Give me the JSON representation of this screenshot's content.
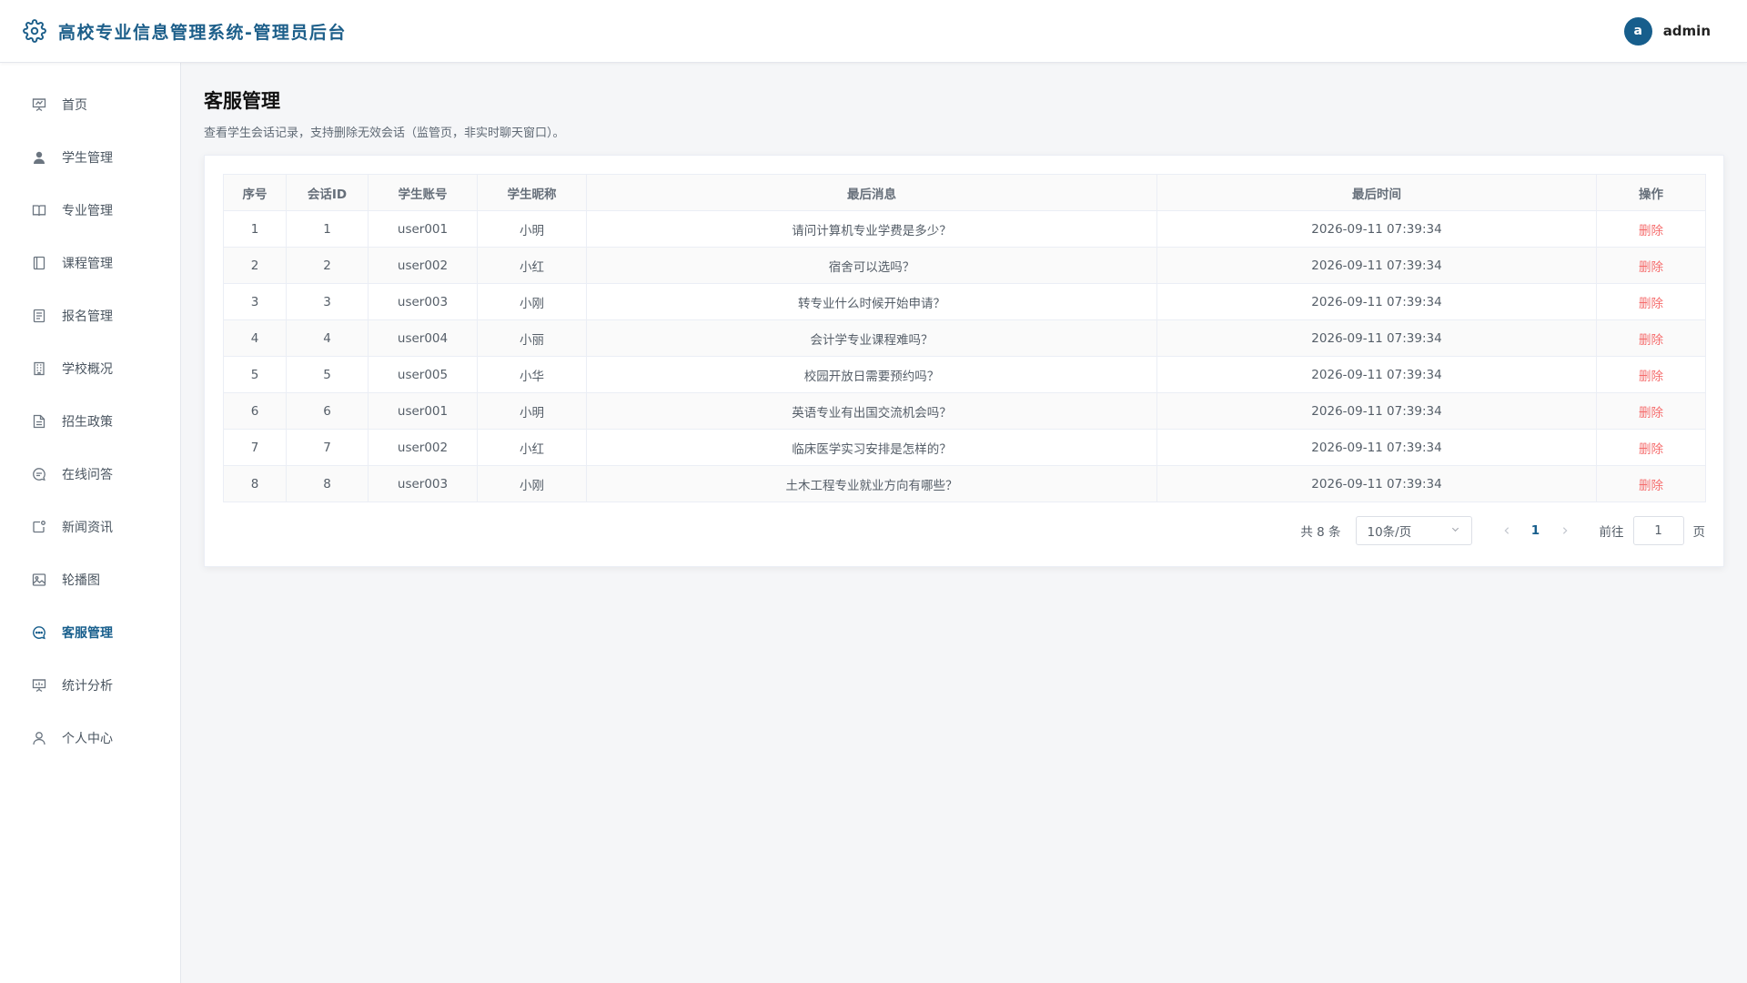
{
  "header": {
    "app_title": "高校专业信息管理系统-管理员后台",
    "avatar_letter": "a",
    "username": "admin"
  },
  "sidebar": {
    "items": [
      {
        "label": "首页",
        "icon": "presentation-icon"
      },
      {
        "label": "学生管理",
        "icon": "user-filled-icon"
      },
      {
        "label": "专业管理",
        "icon": "book-open-icon"
      },
      {
        "label": "课程管理",
        "icon": "notebook-icon"
      },
      {
        "label": "报名管理",
        "icon": "document-icon"
      },
      {
        "label": "学校概况",
        "icon": "office-building-icon"
      },
      {
        "label": "招生政策",
        "icon": "document-lines-icon"
      },
      {
        "label": "在线问答",
        "icon": "chat-line-round-icon"
      },
      {
        "label": "新闻资讯",
        "icon": "news-icon"
      },
      {
        "label": "轮播图",
        "icon": "picture-icon"
      },
      {
        "label": "客服管理",
        "icon": "chat-dots-icon",
        "active": true
      },
      {
        "label": "统计分析",
        "icon": "data-board-icon"
      },
      {
        "label": "个人中心",
        "icon": "user-icon"
      }
    ]
  },
  "main": {
    "title": "客服管理",
    "description": "查看学生会话记录，支持删除无效会话（监管页，非实时聊天窗口）。",
    "table": {
      "headers": [
        "序号",
        "会话ID",
        "学生账号",
        "学生昵称",
        "最后消息",
        "最后时间",
        "操作"
      ],
      "rows": [
        [
          "1",
          "1",
          "user001",
          "小明",
          "请问计算机专业学费是多少？",
          "2026-09-11 07:39:34",
          "删除"
        ],
        [
          "2",
          "2",
          "user002",
          "小红",
          "宿舍可以选吗？",
          "2026-09-11 07:39:34",
          "删除"
        ],
        [
          "3",
          "3",
          "user003",
          "小刚",
          "转专业什么时候开始申请？",
          "2026-09-11 07:39:34",
          "删除"
        ],
        [
          "4",
          "4",
          "user004",
          "小丽",
          "会计学专业课程难吗？",
          "2026-09-11 07:39:34",
          "删除"
        ],
        [
          "5",
          "5",
          "user005",
          "小华",
          "校园开放日需要预约吗？",
          "2026-09-11 07:39:34",
          "删除"
        ],
        [
          "6",
          "6",
          "user001",
          "小明",
          "英语专业有出国交流机会吗？",
          "2026-09-11 07:39:34",
          "删除"
        ],
        [
          "7",
          "7",
          "user002",
          "小红",
          "临床医学实习安排是怎样的？",
          "2026-09-11 07:39:34",
          "删除"
        ],
        [
          "8",
          "8",
          "user003",
          "小刚",
          "土木工程专业就业方向有哪些？",
          "2026-09-11 07:39:34",
          "删除"
        ]
      ]
    },
    "pagination": {
      "total_text": "共 8 条",
      "page_size": "10条/页",
      "prev_icon": "chevron-left-icon",
      "current_page": "1",
      "next_icon": "chevron-right-icon",
      "jump_label": "前往",
      "jump_value": "1",
      "jump_suffix": "页"
    }
  },
  "colors": {
    "primary": "#175e8c",
    "danger": "#f56c6c",
    "background": "#f5f6f8"
  }
}
